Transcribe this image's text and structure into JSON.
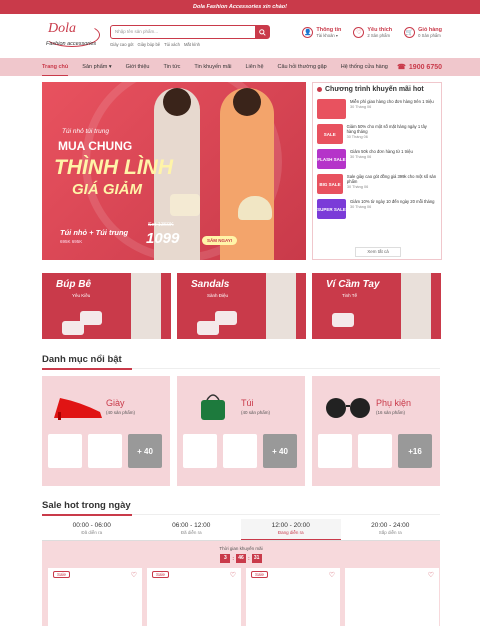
{
  "topbar": {
    "text": "Dola Fashion Accessories xin chào!"
  },
  "logo": {
    "name": "Dola",
    "tagline": "Fashion accessories"
  },
  "search": {
    "placeholder": "Nhập tên sản phẩm...",
    "tags": [
      "Giày cao gót",
      "Giày búp bê",
      "Túi xách",
      "Mắt kính"
    ]
  },
  "header_icons": [
    {
      "icon": "user-icon",
      "title": "Thông tin",
      "sub": "Tài khoản ▾"
    },
    {
      "icon": "heart-icon",
      "title": "Yêu thích",
      "sub": "2 Sản phẩm"
    },
    {
      "icon": "cart-icon",
      "title": "Giỏ hàng",
      "sub": "0 Sản phẩm"
    }
  ],
  "nav": {
    "items": [
      "Trang chủ",
      "Sản phẩm ▾",
      "Giới thiệu",
      "Tin tức",
      "Tin khuyến mãi",
      "Liên hệ",
      "Câu hỏi thường gặp",
      "Hệ thống cửa hàng"
    ],
    "phone": "1900 6750"
  },
  "hero": {
    "line1": "Túi nhỏ túi trung",
    "line2": "MUA CHUNG",
    "line3": "THÌNH LÌNH",
    "line4": "GIÁ GIẢM",
    "combo": "Túi nhỏ + Túi trung",
    "combo_prices": "695K   695K",
    "old_price": "Set 1360K",
    "new_price": "1099",
    "cta": "SẮM NGAY!"
  },
  "promos": {
    "title": "Chương trình khuyến mãi hot",
    "items": [
      {
        "thumb": "",
        "text": "Miễn phí giao hàng cho đơn hàng trên 1 triệu",
        "date": "30 Tháng 06",
        "color": "#e8525f"
      },
      {
        "thumb": "SALE",
        "text": "Giảm 50% cho một số mặt hàng ngày 1 tây hàng tháng",
        "date": "30 Tháng 06",
        "color": "#e8525f"
      },
      {
        "thumb": "FLASH SALE",
        "text": "Giảm 50k cho đơn hàng từ 1 triệu",
        "date": "30 Tháng 06",
        "color": "#b534c9"
      },
      {
        "thumb": "BIG SALE",
        "text": "Sale giày cao gót đồng giá 399k cho một số sản phẩm",
        "date": "30 Tháng 06",
        "color": "#e8525f"
      },
      {
        "thumb": "SUPER SALE",
        "text": "Giảm 10% từ ngày 10 đến ngày 20 mỗi tháng",
        "date": "30 Tháng 06",
        "color": "#7b3bd8"
      }
    ],
    "more": "Xem tất cả"
  },
  "categories": [
    {
      "name": "Búp Bê",
      "sub": "Yêu Kiều"
    },
    {
      "name": "Sandals",
      "sub": "Sành Điệu"
    },
    {
      "name": "Ví Cầm Tay",
      "sub": "Tinh Tế"
    }
  ],
  "featured_title": "Danh mục nổi bật",
  "featured": [
    {
      "name": "Giày",
      "count": "(40 sản phẩm)",
      "more": "+ 40"
    },
    {
      "name": "Túi",
      "count": "(40 sản phẩm)",
      "more": "+ 40"
    },
    {
      "name": "Phụ kiện",
      "count": "(16 sản phẩm)",
      "more": "+16"
    }
  ],
  "sale_title": "Sale hot trong ngày",
  "sale_tabs": [
    {
      "time": "00:00 - 06:00",
      "status": "Đã diễn ra"
    },
    {
      "time": "06:00 - 12:00",
      "status": "Đã diễn ra"
    },
    {
      "time": "12:00 - 20:00",
      "status": "Đang diễn ra"
    },
    {
      "time": "20:00 - 24:00",
      "status": "Sắp diễn ra"
    }
  ],
  "timer": {
    "label": "Thời gian khuyến mãi",
    "h": "3",
    "m": "46",
    "s": "31"
  },
  "sale_tag": "Sale"
}
